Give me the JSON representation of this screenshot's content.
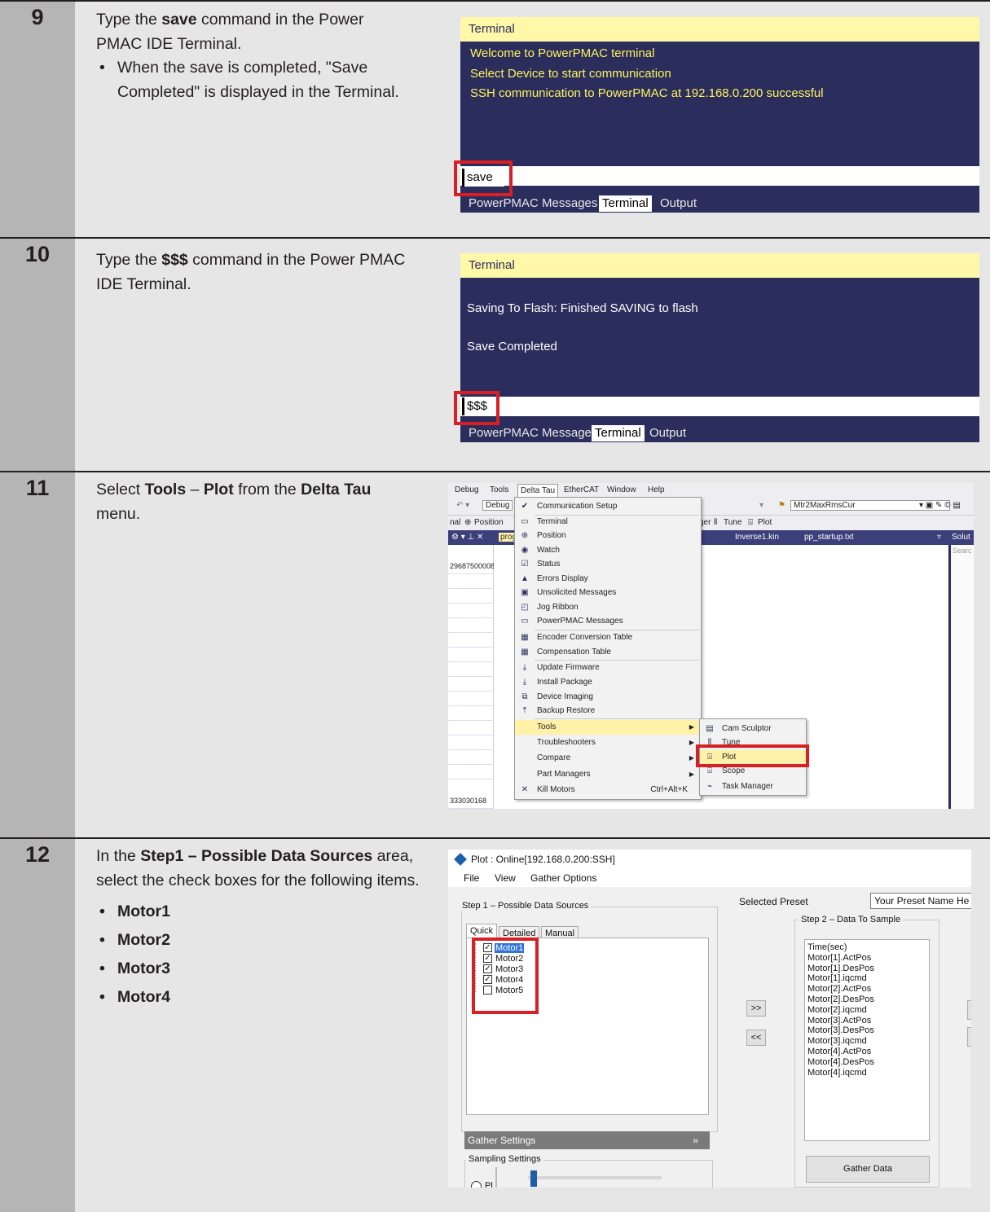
{
  "steps": [
    {
      "number": "9"
    },
    {
      "number": "10"
    },
    {
      "number": "11"
    },
    {
      "number": "12"
    }
  ],
  "step9": {
    "line1_pre": "Type the ",
    "line1_bold": "save",
    "line1_post": " command in the Power",
    "line2": "PMAC IDE Terminal.",
    "bullet": "When the save is completed, \"Save Completed\" is displayed in the Terminal."
  },
  "step10": {
    "pre": "Type the ",
    "bold": "$$$",
    "post": " command in the Power PMAC IDE Terminal."
  },
  "step11": {
    "p1": "Select ",
    "b1": "Tools",
    "p2": " – ",
    "b2": "Plot",
    "p3": " from the ",
    "b3": "Delta Tau",
    "p4": " menu."
  },
  "step12": {
    "p1": "In the ",
    "b1": "Step1 – Possible Data Sources",
    "p2": " area, select the check boxes for the following items.",
    "items": [
      "Motor1",
      "Motor2",
      "Motor3",
      "Motor4"
    ]
  },
  "terminal1": {
    "title": "Terminal",
    "lines": [
      "Welcome to PowerPMAC terminal",
      "Select Device to start communication",
      "SSH communication to PowerPMAC at 192.168.0.200 successful"
    ],
    "input": "save",
    "tabs": [
      "PowerPMAC Messages",
      "Terminal",
      "Output"
    ],
    "active_tab": "Terminal"
  },
  "terminal2": {
    "title": "Terminal",
    "lines": [
      "Saving To Flash: Finished SAVING to flash",
      "Save Completed"
    ],
    "input": "$$$",
    "tabs": [
      "PowerPMAC Messages",
      "Terminal",
      "Output"
    ],
    "active_tab": "Terminal"
  },
  "ide": {
    "menus": [
      "Debug",
      "Tools",
      "Delta Tau",
      "EtherCAT",
      "Window",
      "Help"
    ],
    "toolbar": {
      "config": "Debug",
      "left_fragment": "nal",
      "position": "Position",
      "right_fragment": "ger",
      "tune": "Tune",
      "plot": "Plot",
      "combo_right": "Mtr2MaxRmsCur",
      "doc_tabs": [
        "prog",
        "Inverse1.kin",
        "pp_startup.txt"
      ],
      "solution_pane": "Solut",
      "search": "Searc"
    },
    "left_values": [
      "29687500008",
      "333030168",
      "29687500008"
    ],
    "delta_tau_menu": [
      {
        "label": "Communication Setup",
        "icon": "plug-icon"
      },
      {
        "label": "Terminal",
        "icon": "terminal-icon"
      },
      {
        "label": "Position",
        "icon": "crosshair-icon"
      },
      {
        "label": "Watch",
        "icon": "eye-icon"
      },
      {
        "label": "Status",
        "icon": "check-icon"
      },
      {
        "label": "Errors Display",
        "icon": "warning-icon"
      },
      {
        "label": "Unsolicited Messages",
        "icon": "message-icon"
      },
      {
        "label": "Jog Ribbon",
        "icon": "jog-icon"
      },
      {
        "label": "PowerPMAC Messages",
        "icon": "window-icon"
      },
      {
        "label": "Encoder Conversion Table",
        "icon": "table-icon"
      },
      {
        "label": "Compensation Table",
        "icon": "table-icon"
      },
      {
        "label": "Update Firmware",
        "icon": "download-icon"
      },
      {
        "label": "Install Package",
        "icon": "download-icon"
      },
      {
        "label": "Device Imaging",
        "icon": "device-icon"
      },
      {
        "label": "Backup Restore",
        "icon": "backup-icon"
      },
      {
        "label": "Tools",
        "submenu": true
      },
      {
        "label": "Troubleshooters",
        "submenu": true
      },
      {
        "label": "Compare",
        "submenu": true
      },
      {
        "label": "Part Managers",
        "submenu": true
      },
      {
        "label": "Kill Motors",
        "icon": "close-icon",
        "shortcut": "Ctrl+Alt+K"
      }
    ],
    "tools_submenu": [
      {
        "label": "Cam Sculptor",
        "icon": "cam-icon"
      },
      {
        "label": "Tune",
        "icon": "tune-icon"
      },
      {
        "label": "Plot",
        "icon": "plot-icon",
        "highlighted": true
      },
      {
        "label": "Scope",
        "icon": "scope-icon"
      },
      {
        "label": "Task Manager",
        "icon": "task-icon"
      }
    ]
  },
  "plot": {
    "title": "Plot : Online[192.168.0.200:SSH]",
    "menus": [
      "File",
      "View",
      "Gather Options"
    ],
    "step1_label": "Step 1 – Possible Data Sources",
    "tabs": [
      "Quick",
      "Detailed",
      "Manual"
    ],
    "active_tab": "Quick",
    "motors": [
      {
        "label": "Motor1",
        "checked": true,
        "selected": true
      },
      {
        "label": "Motor2",
        "checked": true
      },
      {
        "label": "Motor3",
        "checked": true
      },
      {
        "label": "Motor4",
        "checked": true
      },
      {
        "label": "Motor5",
        "checked": false
      }
    ],
    "selected_preset_label": "Selected Preset",
    "preset_value": "Your Preset Name He",
    "step2_label": "Step 2 – Data To Sample",
    "samples": [
      "Time(sec)",
      "Motor[1].ActPos",
      "Motor[1].DesPos",
      "Motor[1].iqcmd",
      "Motor[2].ActPos",
      "Motor[2].DesPos",
      "Motor[2].iqcmd",
      "Motor[3].ActPos",
      "Motor[3].DesPos",
      "Motor[3].iqcmd",
      "Motor[4].ActPos",
      "Motor[4].DesPos",
      "Motor[4].iqcmd"
    ],
    "add_button": ">>",
    "remove_button": "<<",
    "gather_settings": "Gather Settings",
    "sampling_settings": "Sampling Settings",
    "radio_label": "Pl",
    "gather_data_button": "Gather Data"
  }
}
